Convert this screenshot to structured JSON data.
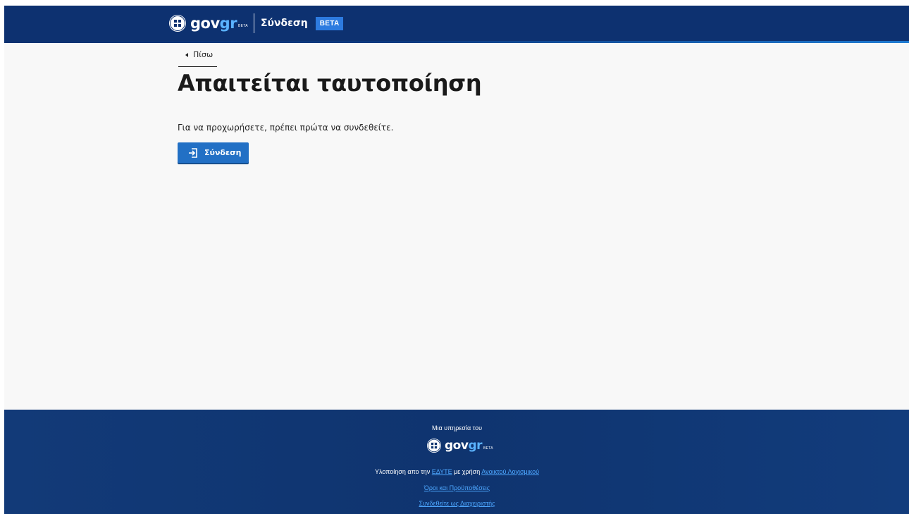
{
  "header": {
    "logo": {
      "text_main": "gov",
      "text_accent": "gr",
      "beta_tag": "BETA",
      "emblem_icon": "greek-coat-of-arms-icon"
    },
    "title": "Σύνδεση",
    "badge": "BETA"
  },
  "main": {
    "back_label": "Πίσω",
    "title": "Απαιτείται ταυτοποίηση",
    "description": "Για να προχωρήσετε, πρέπει πρώτα να συνδεθείτε.",
    "login_button": {
      "label": "Σύνδεση",
      "icon": "login-icon"
    }
  },
  "footer": {
    "service_of": "Μια υπηρεσία του",
    "logo": {
      "text_main": "gov",
      "text_accent": "gr",
      "beta_tag": "BETA"
    },
    "impl_prefix": "Υλοποίηση απο την",
    "impl_org": "ΕΔΥΤΕ",
    "impl_middle": "με χρήση",
    "impl_software": "Ανοικτού Λογισμικού",
    "terms_link": "Όροι και Προϋποθέσεις",
    "admin_link": "Συνδεθείτε ως Διαχειριστής"
  },
  "colors": {
    "header_bg": "#0d3170",
    "accent": "#5bb3ff",
    "badge_bg": "#2d7be0",
    "button_bg": "#2270c5",
    "footer_bg": "#0f346f",
    "link": "#4da7ff",
    "page_bg": "#f8f8f8"
  }
}
